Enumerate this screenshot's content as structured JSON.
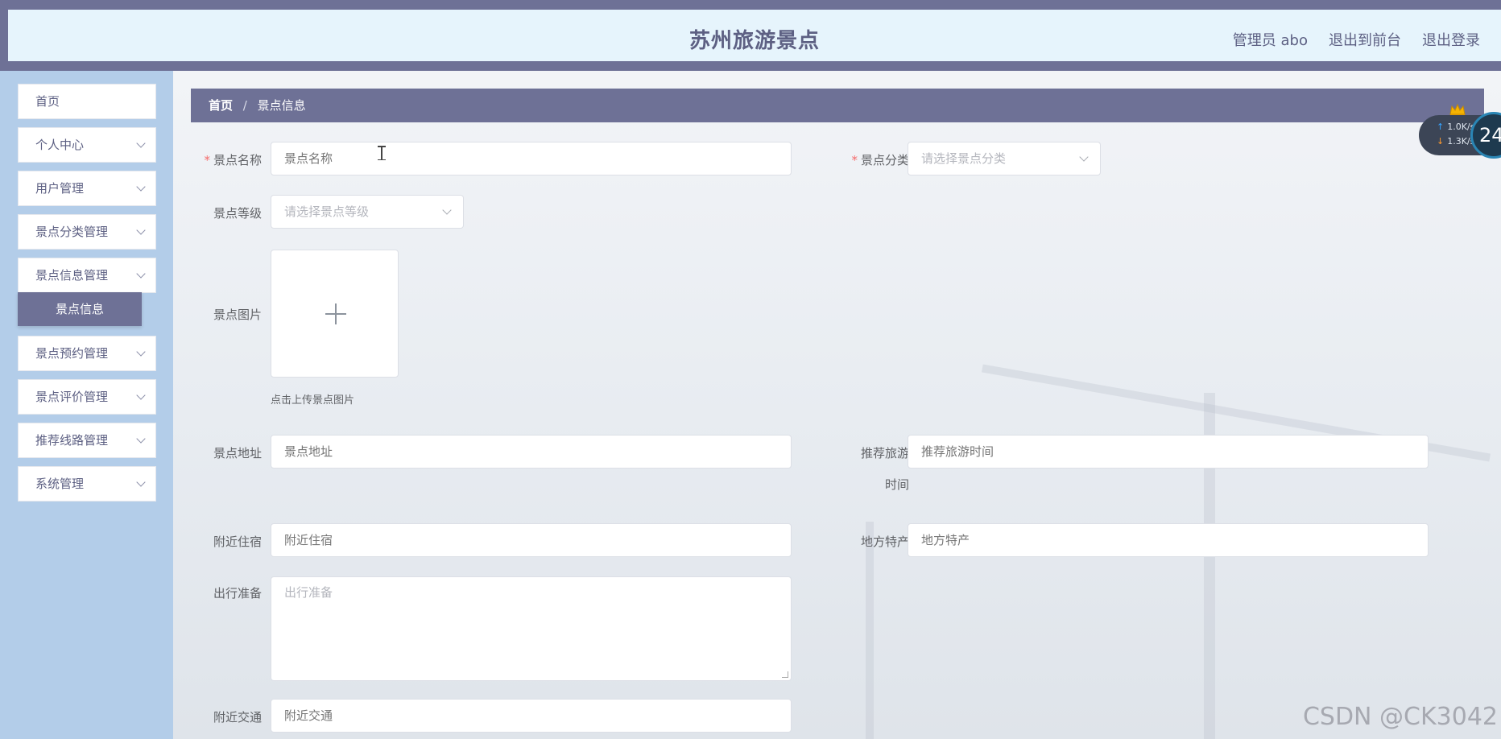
{
  "header": {
    "title": "苏州旅游景点",
    "user_label": "管理员 abo",
    "front_link": "退出到前台",
    "logout_link": "退出登录"
  },
  "sidebar": {
    "items": [
      {
        "label": "首页",
        "expandable": false
      },
      {
        "label": "个人中心",
        "expandable": true
      },
      {
        "label": "用户管理",
        "expandable": true
      },
      {
        "label": "景点分类管理",
        "expandable": true
      },
      {
        "label": "景点信息管理",
        "expandable": true
      },
      {
        "label": "景点预约管理",
        "expandable": true
      },
      {
        "label": "景点评价管理",
        "expandable": true
      },
      {
        "label": "推荐线路管理",
        "expandable": true
      },
      {
        "label": "系统管理",
        "expandable": true
      }
    ],
    "active_subitem": "景点信息"
  },
  "breadcrumb": {
    "home": "首页",
    "separator": "/",
    "current": "景点信息"
  },
  "form": {
    "name": {
      "label": "景点名称",
      "required": true,
      "placeholder": "景点名称",
      "value": ""
    },
    "category": {
      "label": "景点分类",
      "required": true,
      "placeholder": "请选择景点分类",
      "value": ""
    },
    "level": {
      "label": "景点等级",
      "required": false,
      "placeholder": "请选择景点等级",
      "value": ""
    },
    "image": {
      "label": "景点图片",
      "tip": "点击上传景点图片"
    },
    "address": {
      "label": "景点地址",
      "placeholder": "景点地址",
      "value": ""
    },
    "recommend_time": {
      "label_line1": "推荐旅游",
      "label_line2": "时间",
      "placeholder": "推荐旅游时间",
      "value": ""
    },
    "lodging": {
      "label": "附近住宿",
      "placeholder": "附近住宿",
      "value": ""
    },
    "specialty": {
      "label": "地方特产",
      "placeholder": "地方特产",
      "value": ""
    },
    "preparation": {
      "label": "出行准备",
      "placeholder": "出行准备",
      "value": ""
    },
    "transport": {
      "label": "附近交通",
      "placeholder": "附近交通",
      "value": ""
    }
  },
  "net_widget": {
    "upload_speed": "1.0K/s",
    "download_speed": "1.3K/s",
    "badge": "24"
  },
  "watermark": "CSDN @CK3042",
  "colors": {
    "primary": "#6e7196",
    "header_bg": "#e6f4fc",
    "sidebar_bg": "#b3cde9",
    "required": "#f56c6c"
  }
}
